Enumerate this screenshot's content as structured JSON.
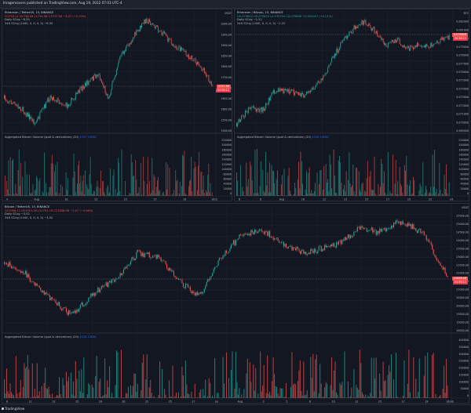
{
  "header": {
    "text": "Imagemovers published on TradingView.com, Aug 19, 2022 07:03 UTC-4"
  },
  "footer": {
    "brand": "TradingView"
  },
  "colors": {
    "up": "#26a69a",
    "down": "#ef5350",
    "grid": "#1f2330",
    "bg": "#131722",
    "vol_label": "#2962ff"
  },
  "panes": {
    "ethusd": {
      "title": "Ethereum / TetherUS, 15, BINANCE",
      "ohlc": "O1735.11 H1738.06 L1734.56 C1737.56 −3.47 (−0.19%)",
      "line2": "Daily SCng  −6.35",
      "line3": "24H SCng (1440, 0, 0, 0, 0)  −6.35",
      "price_tag": "1737.56",
      "price_tag2": "04:56:11",
      "y_ticks": [
        "USDT",
        "2000.00",
        "1950.00",
        "1900.00",
        "1850.00",
        "1800.00",
        "1750.00",
        "1700.00",
        "1650.00",
        "1600.00",
        "1550.00",
        "1500.00"
      ],
      "vol_title": "Aggregated Bitcoin Volume (spot & derivatives) (20)",
      "vol_val": "4707  13081",
      "vol_ticks": [
        "220000",
        "200000",
        "180000",
        "160000",
        "140000",
        "120000",
        "100000",
        "80000",
        "60000",
        "40000",
        "20000",
        "0"
      ],
      "x_ticks": [
        "4",
        "Aug",
        "10",
        "13",
        "15",
        "17",
        "19",
        "16:0"
      ]
    },
    "ethbtc": {
      "title": "Ethereum / Bitcoin, 15, BINANCE",
      "ohlc": "O0.079802 H0.079819 L0.079794 C0.079806 +0.000007 (+0.01%)",
      "line2": "Daily SCng  −1.22",
      "line3": "24H SCng (1440, 0, 0, 0, 0)  −1.22",
      "price_tag": "0.079806",
      "price_tag2": "04:56:11",
      "y_ticks": [
        "BTC",
        "0.082000",
        "0.081000",
        "0.080000",
        "0.079000",
        "0.078000",
        "0.077000",
        "0.076000",
        "0.075000",
        "0.074000",
        "0.073000",
        "0.072000",
        "0.071000",
        "0.070000",
        "0.069000"
      ],
      "vol_title": "Aggregated Bitcoin Volume (spot & derivatives) (20)",
      "vol_val": "4426  13081",
      "vol_ticks": [
        "220000",
        "200000",
        "180000",
        "160000",
        "140000",
        "120000",
        "100000",
        "80000",
        "60000",
        "40000",
        "20000",
        "0"
      ],
      "x_ticks": [
        "6",
        "8",
        "Aug",
        "10",
        "12",
        "13",
        "15",
        "17",
        "19",
        "22",
        "24"
      ]
    },
    "btcusd": {
      "title": "Bitcoin / TetherUS, 15, BINANCE",
      "ohlc": "O21908.11 H21921.16 L21751.19 C21838.06 −1.07 (−0.06%)",
      "line2": "Daily SCng  −3.52",
      "line3": "24H SCng (1440, 0, 0, 0, 0)  −3.52",
      "price_tag": "21838.06",
      "price_tag2": "04:56:11",
      "y_ticks": [
        "USDT",
        "25500.00",
        "25000.00",
        "24500.00",
        "24000.00",
        "23500.00",
        "23000.00",
        "22500.00",
        "22000.00",
        "21500.00",
        "21000.00",
        "20500.00",
        "20000.00",
        "19500.00",
        "19000.00",
        "18500.00"
      ],
      "vol_title": "Aggregated Bitcoin Volume (spot & derivatives) (20)",
      "vol_val": "4426  13081",
      "vol_ticks": [
        "400000",
        "350000",
        "300000",
        "250000",
        "200000",
        "150000",
        "100000",
        "50000",
        "0"
      ],
      "x_ticks": [
        "8",
        "11",
        "13",
        "15",
        "18",
        "20",
        "22",
        "25",
        "27",
        "Jul",
        "Aug",
        "3",
        "5",
        "8",
        "10",
        "12",
        "15",
        "17",
        "19",
        "16:00"
      ]
    }
  }
}
